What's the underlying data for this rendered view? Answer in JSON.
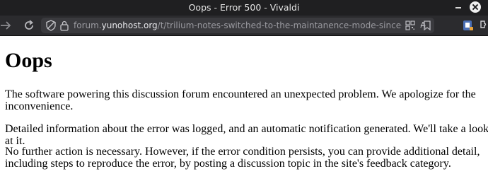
{
  "window": {
    "title": "Oops - Error 500 - Vivaldi"
  },
  "toolbar": {
    "url_prefix": "forum.",
    "url_host": "yunohost.org",
    "url_path": "/t/trilium-notes-switched-to-the-maintanence-mode-since-j...",
    "translate_label": "A̶"
  },
  "page": {
    "heading": "Oops",
    "paragraph1": "The software powering this discussion forum encountered an unexpected problem. We apologize for the inconvenience.",
    "paragraph2": "Detailed information about the error was logged, and an automatic notification generated. We'll take a look at it.",
    "paragraph3": "No further action is necessary. However, if the error condition persists, you can provide additional detail, including steps to reproduce the error, by posting a discussion topic in the site's feedback category."
  }
}
